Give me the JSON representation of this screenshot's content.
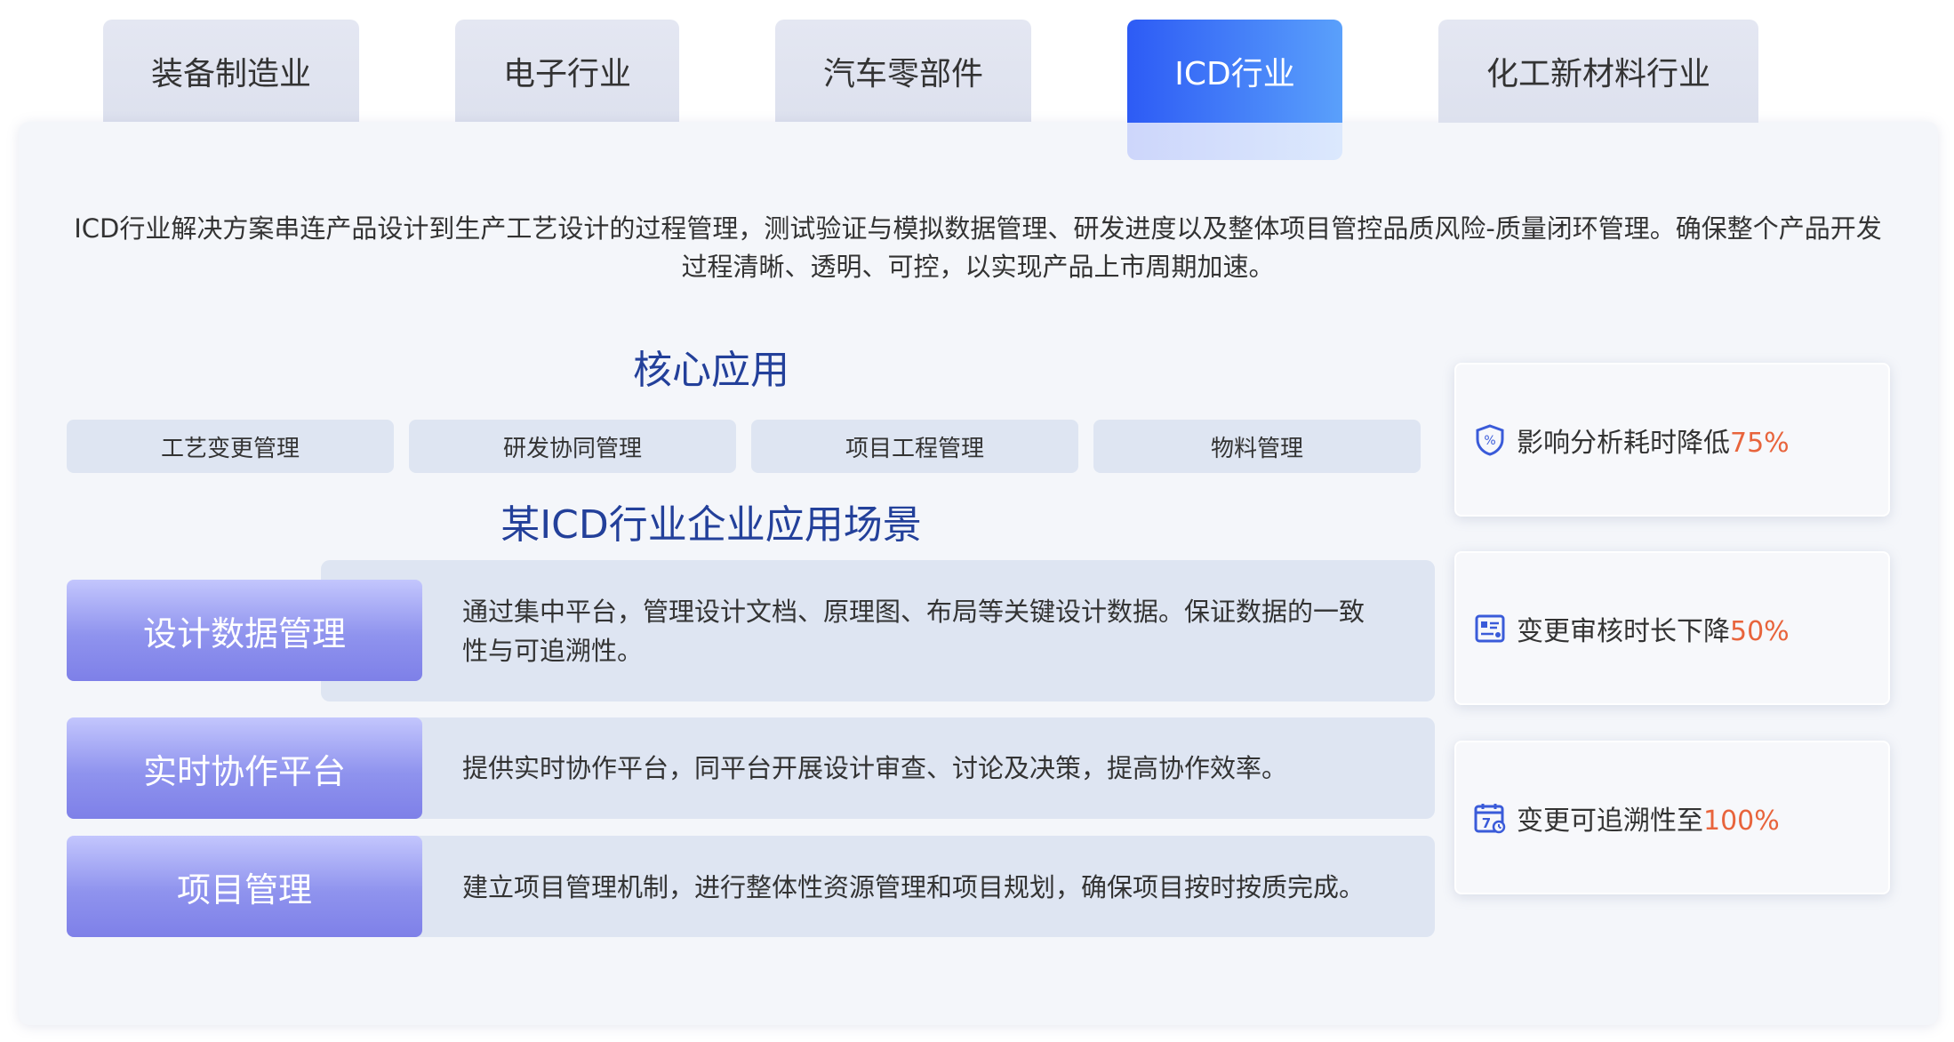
{
  "tabs": [
    {
      "label": "装备制造业"
    },
    {
      "label": "电子行业"
    },
    {
      "label": "汽车零部件"
    },
    {
      "label": "ICD行业"
    },
    {
      "label": "化工新材料行业"
    }
  ],
  "intro": "ICD行业解决方案串连产品设计到生产工艺设计的过程管理，测试验证与模拟数据管理、研发进度以及整体项目管控品质风险-质量闭环管理。确保整个产品开发过程清晰、透明、可控，以实现产品上市周期加速。",
  "core": {
    "title": "核心应用",
    "chips": [
      "工艺变更管理",
      "研发协同管理",
      "项目工程管理",
      "物料管理"
    ]
  },
  "scenes": {
    "title": "某ICD行业企业应用场景",
    "items": [
      {
        "label": "设计数据管理",
        "text": "通过集中平台，管理设计文档、原理图、布局等关键设计数据。保证数据的一致性与可追溯性。"
      },
      {
        "label": "实时协作平台",
        "text": "提供实时协作平台，同平台开展设计审查、讨论及决策，提高协作效率。"
      },
      {
        "label": "项目管理",
        "text": "建立项目管理机制，进行整体性资源管理和项目规划，确保项目按时按质完成。"
      }
    ]
  },
  "stats": [
    {
      "icon": "shield-percent-icon",
      "text": "影响分析耗时降低",
      "value": "75%"
    },
    {
      "icon": "review-list-icon",
      "text": "变更审核时长下降",
      "value": "50%"
    },
    {
      "icon": "calendar-seven-icon",
      "text": "变更可追溯性至",
      "value": "100%"
    }
  ],
  "colors": {
    "accent": "#2d5bf5",
    "title": "#23409a",
    "highlight": "#e8643c",
    "label_gradient_end": "#7e80e8"
  }
}
